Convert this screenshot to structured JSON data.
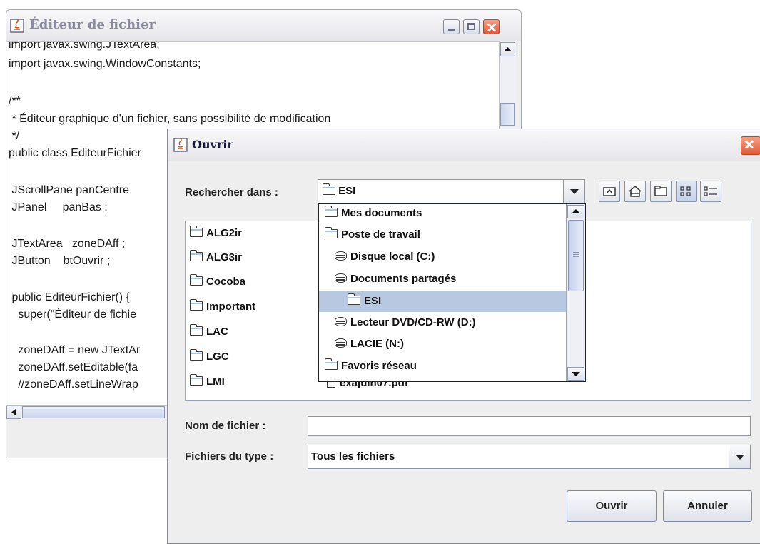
{
  "editor_window": {
    "title": "Éditeur de fichier",
    "code_lines": [
      "import javax.swing.JTextArea;",
      "import javax.swing.WindowConstants;",
      "",
      "/**",
      " * Éditeur graphique d'un fichier, sans possibilité de modification",
      " */",
      "public class EditeurFichier",
      "",
      " JScrollPane panCentre",
      " JPanel     panBas ;",
      "",
      " JTextArea   zoneDAff ;",
      " JButton    btOuvrir ;",
      "",
      " public EditeurFichier() {",
      "   super(\"Éditeur de fichie",
      "",
      "   zoneDAff = new JTextAr",
      "   zoneDAff.setEditable(fa",
      "   //zoneDAff.setLineWrap"
    ]
  },
  "open_dialog": {
    "title": "Ouvrir",
    "look_in_label": "Rechercher dans :",
    "look_in_value": "ESI",
    "toolbar_icons": [
      "up-one-level-icon",
      "home-icon",
      "new-folder-icon",
      "list-view-icon",
      "details-view-icon"
    ],
    "files": [
      {
        "name": "ALG2ir",
        "type": "folder"
      },
      {
        "name": "ALG3ir",
        "type": "folder"
      },
      {
        "name": "Cocoba",
        "type": "folder"
      },
      {
        "name": "Important",
        "type": "folder"
      },
      {
        "name": "LAC",
        "type": "folder"
      },
      {
        "name": "LGC",
        "type": "folder"
      },
      {
        "name": "LMI",
        "type": "folder"
      },
      {
        "name": "exajuin07.pdf",
        "type": "file"
      }
    ],
    "dropdown_items": [
      {
        "label": "Mes documents",
        "icon": "folder",
        "indent": 0,
        "selected": false
      },
      {
        "label": "Poste de travail",
        "icon": "folder",
        "indent": 0,
        "selected": false
      },
      {
        "label": "Disque local (C:)",
        "icon": "disk",
        "indent": 1,
        "selected": false
      },
      {
        "label": "Documents partagés",
        "icon": "disk",
        "indent": 1,
        "selected": false
      },
      {
        "label": "ESI",
        "icon": "folder",
        "indent": 2,
        "selected": true
      },
      {
        "label": "Lecteur DVD/CD-RW (D:)",
        "icon": "disk",
        "indent": 1,
        "selected": false
      },
      {
        "label": "LACIE (N:)",
        "icon": "disk",
        "indent": 1,
        "selected": false
      },
      {
        "label": "Favoris réseau",
        "icon": "folder",
        "indent": 0,
        "selected": false
      }
    ],
    "file_name_label_mnemonic": "N",
    "file_name_label_rest": "om de fichier :",
    "file_name_value": "",
    "file_type_label": "Fichiers du type :",
    "file_type_value": "Tous les fichiers",
    "open_button": "Ouvrir",
    "cancel_button": "Annuler"
  },
  "colors": {
    "selection": "#b8c8e0",
    "close_button": "#e05a35",
    "window_bg": "#eeeeee"
  }
}
